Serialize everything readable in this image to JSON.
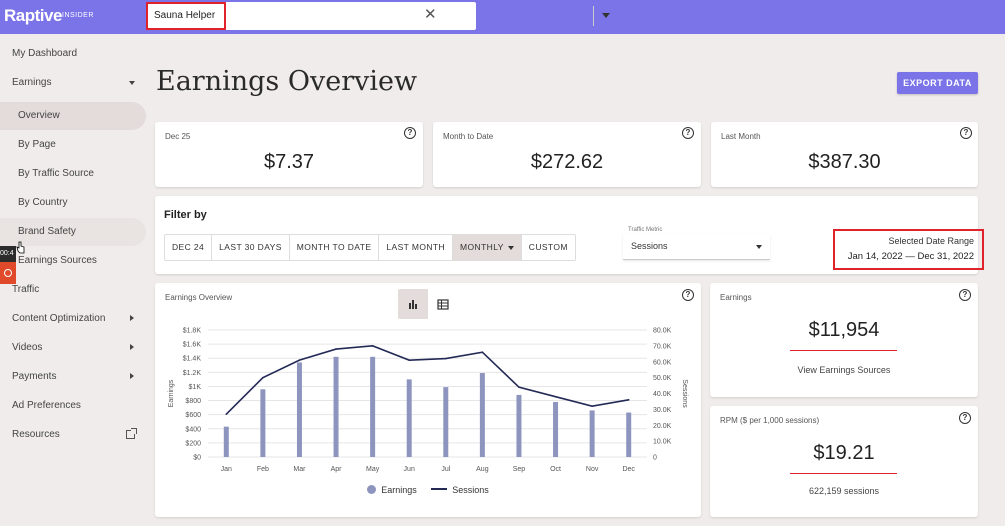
{
  "header": {
    "logo": "Raptive",
    "logo_sub": "INSIDER",
    "site_selector": {
      "value": "Sauna Helper",
      "clear_icon": "close-icon",
      "dropdown_icon": "caret-down-icon"
    }
  },
  "sidebar": {
    "items": [
      {
        "label": "My Dashboard"
      },
      {
        "label": "Earnings"
      },
      {
        "label": "Overview"
      },
      {
        "label": "By Page"
      },
      {
        "label": "By Traffic Source"
      },
      {
        "label": "By Country"
      },
      {
        "label": "Brand Safety"
      },
      {
        "label": "Earnings Sources"
      },
      {
        "label": "Traffic"
      },
      {
        "label": "Content Optimization"
      },
      {
        "label": "Videos"
      },
      {
        "label": "Payments"
      },
      {
        "label": "Ad Preferences"
      },
      {
        "label": "Resources"
      }
    ],
    "recorder_time": "00:4"
  },
  "main": {
    "title": "Earnings Overview",
    "export_label": "EXPORT DATA",
    "stats": [
      {
        "label": "Dec 25",
        "value": "$7.37"
      },
      {
        "label": "Month to Date",
        "value": "$272.62"
      },
      {
        "label": "Last Month",
        "value": "$387.30"
      }
    ],
    "filter": {
      "title": "Filter by",
      "buttons": [
        "DEC 24",
        "LAST 30 DAYS",
        "MONTH TO DATE",
        "LAST MONTH",
        "MONTHLY",
        "CUSTOM"
      ],
      "active": "MONTHLY",
      "traffic_metric_label": "Traffic Metric",
      "traffic_metric_value": "Sessions",
      "date_range_title": "Selected Date Range",
      "date_range_value": "Jan 14, 2022 — Dec 31, 2022"
    },
    "chart_card_title": "Earnings Overview",
    "earnings_card": {
      "label": "Earnings",
      "value": "$11,954",
      "link": "View Earnings Sources"
    },
    "rpm_card": {
      "label": "RPM ($ per 1,000 sessions)",
      "value": "$19.21",
      "sub": "622,159 sessions"
    }
  },
  "chart_data": {
    "type": "bar",
    "categories": [
      "Jan",
      "Feb",
      "Mar",
      "Apr",
      "May",
      "Jun",
      "Jul",
      "Aug",
      "Sep",
      "Oct",
      "Nov",
      "Dec"
    ],
    "series": [
      {
        "name": "Earnings",
        "type": "bar",
        "axis": "left",
        "color": "#8d95be",
        "values": [
          430,
          960,
          1340,
          1420,
          1420,
          1100,
          990,
          1190,
          880,
          780,
          660,
          630
        ]
      },
      {
        "name": "Sessions",
        "type": "line",
        "axis": "right",
        "color": "#232a56",
        "values": [
          27000,
          50000,
          61000,
          68000,
          70000,
          61000,
          62000,
          66000,
          44000,
          38000,
          32000,
          36000
        ]
      }
    ],
    "ylabel": "Earnings",
    "y2label": "Sessions",
    "ylim": [
      0,
      1800
    ],
    "y2lim": [
      0,
      80000
    ],
    "yticks": [
      "$0",
      "$200",
      "$400",
      "$600",
      "$800",
      "$1K",
      "$1.2K",
      "$1.4K",
      "$1.6K",
      "$1.8K"
    ],
    "y2ticks": [
      "0",
      "10.0K",
      "20.0K",
      "30.0K",
      "40.0K",
      "50.0K",
      "60.0K",
      "70.0K",
      "80.0K"
    ],
    "grid": true,
    "legend": "bottom"
  }
}
